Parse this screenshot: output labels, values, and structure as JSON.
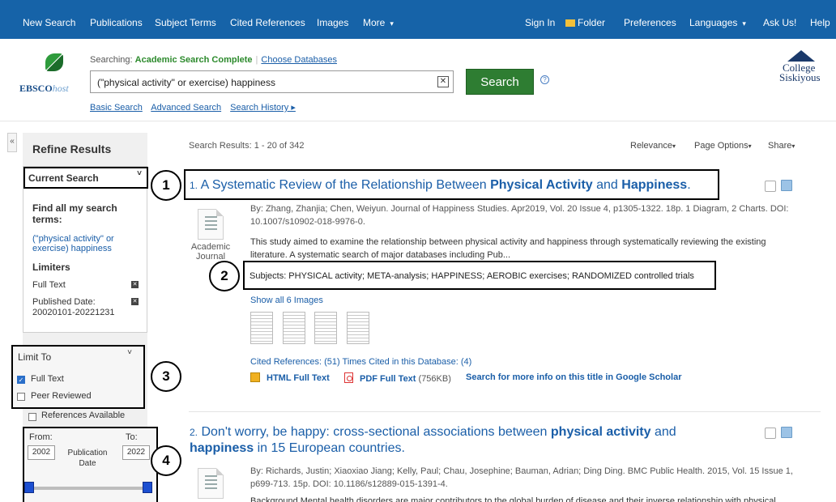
{
  "nav": {
    "new_search": "New Search",
    "publications": "Publications",
    "subject_terms": "Subject Terms",
    "cited_references": "Cited References",
    "images": "Images",
    "more": "More",
    "sign_in": "Sign In",
    "folder": "Folder",
    "preferences": "Preferences",
    "languages": "Languages",
    "ask_us": "Ask Us!",
    "help": "Help"
  },
  "header": {
    "logo_main": "EBSCO",
    "logo_suffix": "host",
    "searching_label": "Searching:",
    "database": "Academic Search Complete",
    "choose_databases": "Choose Databases",
    "query": "(\"physical activity\" or exercise) happiness",
    "search_button": "Search",
    "basic_search": "Basic Search",
    "advanced_search": "Advanced Search",
    "search_history": "Search History ▸",
    "college_line1": "College",
    "college_line2": "Siskiyous"
  },
  "sidebar": {
    "refine_title": "Refine Results",
    "current_search": "Current Search",
    "find_all_label": "Find all my search terms:",
    "find_all_value": "(\"physical activity\" or exercise) happiness",
    "limiters_label": "Limiters",
    "limiter_full_text": "Full Text",
    "limiter_pub_date_label": "Published Date:",
    "limiter_pub_date_value": "20020101-20221231",
    "limit_to": "Limit To",
    "full_text": "Full Text",
    "peer_reviewed": "Peer Reviewed",
    "references_available": "References Available",
    "from_label": "From:",
    "to_label": "To:",
    "from_value": "2002",
    "to_value": "2022",
    "pub_date_label": "Publication Date"
  },
  "results": {
    "count_label": "Search Results:",
    "count_value": "1 - 20 of 342",
    "relevance": "Relevance",
    "page_options": "Page Options",
    "share": "Share",
    "r1": {
      "num": "1.",
      "title_a": "A Systematic Review of the Relationship Between ",
      "title_b": "Physical Activity",
      "title_c": " and ",
      "title_d": "Happiness",
      "title_e": ".",
      "meta_line1": "By: Zhang, Zhanjia; Chen, Weiyun. Journal of Happiness Studies. Apr2019, Vol. 20 Issue 4, p1305-1322. 18p. 1 Diagram, 2 Charts. DOI:",
      "meta_line2": "10.1007/s10902-018-9976-0.",
      "abstract_line1": "This study aimed to examine the relationship between physical activity and happiness through systematically reviewing the existing",
      "abstract_line2": "literature. A systematic search of major databases including Pub...",
      "doc_type": "Academic Journal",
      "subjects": "Subjects: PHYSICAL activity; META-analysis; HAPPINESS; AEROBIC exercises; RANDOMIZED controlled trials",
      "show_images": "Show all 6 Images",
      "cited": "Cited References: (51) Times Cited in this Database: (4)",
      "html_full_text": "HTML Full Text",
      "pdf_full_text": "PDF Full Text",
      "pdf_size": "(756KB)",
      "google_scholar": "Search for more info on this title in Google Scholar"
    },
    "r2": {
      "num": "2.",
      "title_a": "Don't worry, be happy: cross-sectional associations between ",
      "title_b": "physical activity",
      "title_c": " and",
      "title_d": "happiness",
      "title_e": " in 15 European countries.",
      "meta_line1": "By: Richards, Justin; Xiaoxiao Jiang; Kelly, Paul; Chau, Josephine; Bauman, Adrian; Ding Ding. BMC Public Health. 2015, Vol. 15 Issue 1,",
      "meta_line2": "p699-713. 15p. DOI: 10.1186/s12889-015-1391-4.",
      "abstract_line1": "Background Mental health disorders are major contributors to the global burden of disease and their inverse relationship with physical"
    }
  },
  "callouts": [
    "1",
    "2",
    "3",
    "4"
  ],
  "colors": {
    "nav_bg": "#1663a8",
    "search_btn": "#2e7d32",
    "link": "#1a5ea8",
    "database_green": "#2c8a2c"
  }
}
